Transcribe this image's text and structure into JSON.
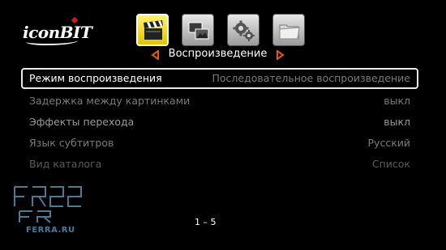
{
  "brand": {
    "logo_text": "iconBIT",
    "watermark_text": "FERRA.RU"
  },
  "toolbar": {
    "icons": [
      {
        "name": "movie-clapper-icon",
        "active": true
      },
      {
        "name": "photo-gallery-icon",
        "active": false
      },
      {
        "name": "settings-gears-icon",
        "active": false
      },
      {
        "name": "folder-icon",
        "active": false
      }
    ]
  },
  "section": {
    "title": "Воспроизведение"
  },
  "menu": {
    "rows": [
      {
        "label": "Режим воспроизведения",
        "value": "Последовательное воспроизведение"
      },
      {
        "label": "Задержка между картинками",
        "value": "выкл"
      },
      {
        "label": "Эффекты перехода",
        "value": "выкл"
      },
      {
        "label": "Язык субтитров",
        "value": "Русский"
      },
      {
        "label": "Вид каталога",
        "value": "Список"
      }
    ]
  },
  "pagination": {
    "text": "1 – 5"
  },
  "colors": {
    "accent_orange": "#e05a10",
    "active_tile": "#f5e030",
    "watermark_blue": "#4a7a96"
  }
}
